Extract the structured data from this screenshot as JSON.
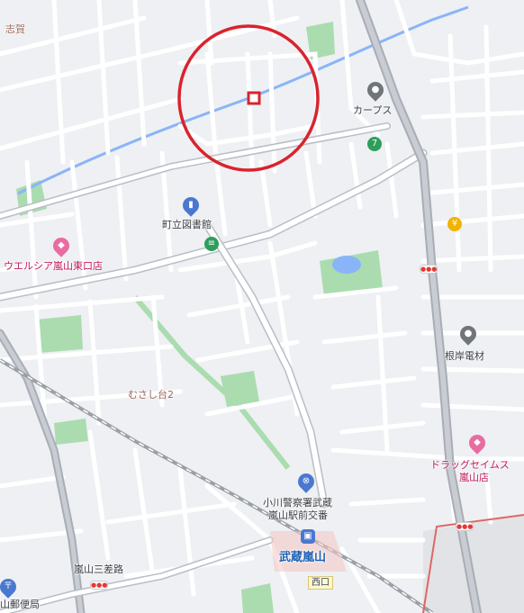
{
  "map": {
    "places": {
      "shiga": "志賀",
      "carps": "カープス",
      "library": "町立図書館",
      "welcia": "ウエルシア嵐山東口店",
      "negishi": "根岸電材",
      "musashidai": "むさし台2",
      "police_line1": "小川警察署武蔵",
      "police_line2": "嵐山駅前交番",
      "drug_line1": "ドラッグセイムス",
      "drug_line2": "嵐山店",
      "station": "武蔵嵐山",
      "west_exit": "西口",
      "sansaro": "嵐山三差路",
      "post_office": "山郵便局"
    },
    "colors": {
      "background": "#eef0f3",
      "road": "#ffffff",
      "major_road": "#b9bec6",
      "park": "#aadcb0",
      "water": "#8ab4f8",
      "railway": "#9aa0a6",
      "selection_circle": "#d9232d",
      "boundary": "#e06666",
      "shop_pin": "#e86ca1",
      "poi_gray": "#70757a",
      "station_badge": "#4a78d0"
    },
    "icons": [
      "location-pin-icon",
      "shopping-pin-icon",
      "convenience-store-icon",
      "library-icon",
      "bus-stop-icon",
      "police-icon",
      "train-station-icon",
      "post-office-icon",
      "traffic-light-icon"
    ]
  }
}
